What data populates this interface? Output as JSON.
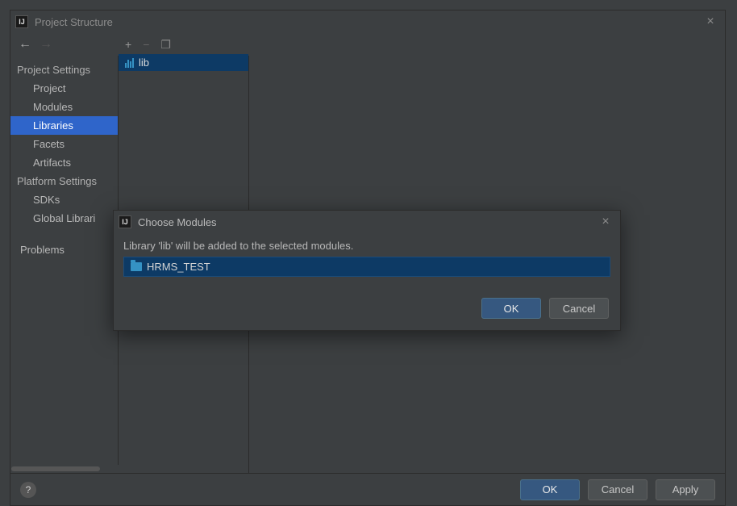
{
  "window": {
    "title": "Project Structure",
    "icon_text": "IJ"
  },
  "sidebar": {
    "project_settings_header": "Project Settings",
    "items": [
      {
        "label": "Project"
      },
      {
        "label": "Modules"
      },
      {
        "label": "Libraries",
        "selected": true
      },
      {
        "label": "Facets"
      },
      {
        "label": "Artifacts"
      }
    ],
    "platform_settings_header": "Platform Settings",
    "platform_items": [
      {
        "label": "SDKs"
      },
      {
        "label": "Global Librari"
      }
    ],
    "problems_label": "Problems"
  },
  "library_list": {
    "selected_library": "lib"
  },
  "modal": {
    "title": "Choose Modules",
    "icon_text": "IJ",
    "message": "Library 'lib' will be added to the selected modules.",
    "module_name": "HRMS_TEST",
    "ok_label": "OK",
    "cancel_label": "Cancel"
  },
  "footer": {
    "help_label": "?",
    "ok_label": "OK",
    "cancel_label": "Cancel",
    "apply_label": "Apply"
  }
}
